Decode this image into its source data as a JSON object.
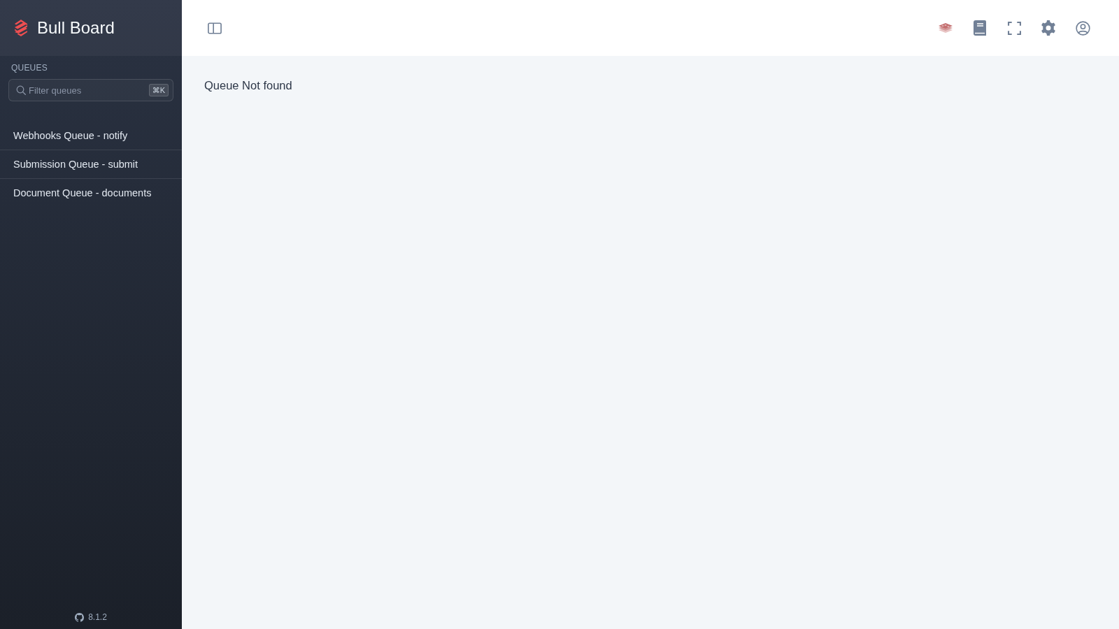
{
  "sidebar": {
    "title": "Bull Board",
    "section_label": "QUEUES",
    "search": {
      "placeholder": "Filter queues",
      "shortcut": "⌘K"
    },
    "queues": [
      {
        "label": "Webhooks Queue - notify",
        "selected": false
      },
      {
        "label": "Submission Queue - submit",
        "selected": false
      },
      {
        "label": "Document Queue - documents",
        "selected": false
      }
    ],
    "version": "8.1.2"
  },
  "main": {
    "message": "Queue Not found"
  }
}
